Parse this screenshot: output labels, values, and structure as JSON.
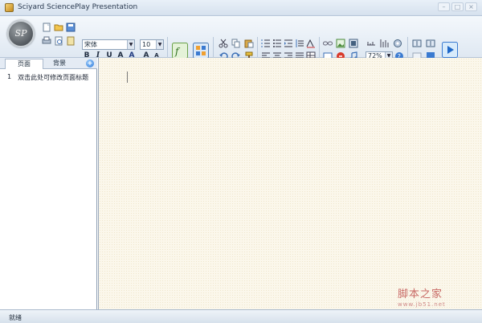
{
  "window": {
    "title": "Sciyard SciencePlay Presentation"
  },
  "app_logo": {
    "text": "SP"
  },
  "colors": {
    "titlebar": "#dce6f1",
    "canvas": "#fbf7eb",
    "accent": "#2a76d6",
    "watermark": "#c86a66"
  },
  "toolbar": {
    "font_name": "宋体",
    "font_size": "10",
    "zoom": "72%",
    "format_buttons": {
      "bold": "B",
      "italic": "I",
      "underline": "U",
      "font_color": "A",
      "highlight": "A",
      "grow": "A",
      "shrink": "A"
    }
  },
  "sidebar": {
    "tabs": [
      "页面",
      "背景"
    ],
    "pages": [
      {
        "index": "1",
        "title": "双击此处可修改页面标题"
      }
    ]
  },
  "watermark": {
    "main": "脚本之家",
    "sub": "www.jb51.net"
  },
  "status": {
    "text": "就绪"
  }
}
